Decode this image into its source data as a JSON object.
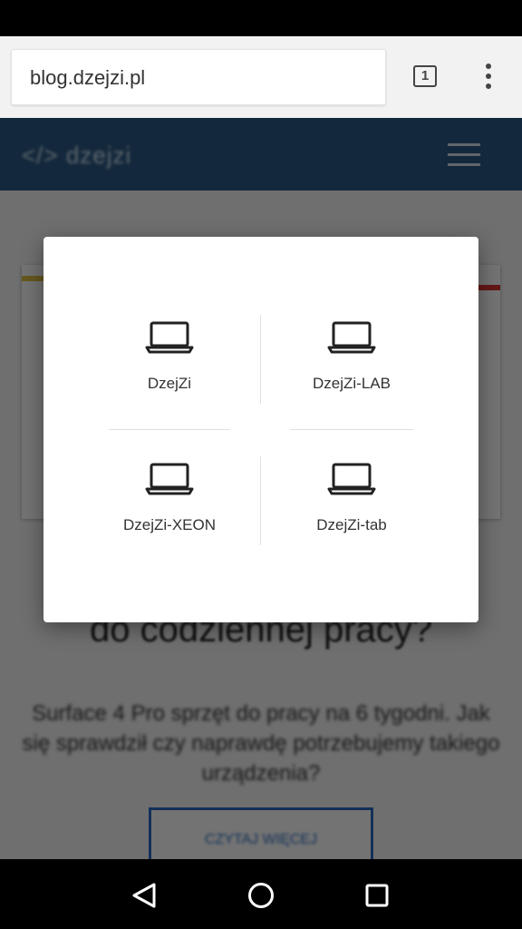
{
  "browser": {
    "url": "blog.dzejzi.pl",
    "tab_count": "1"
  },
  "dialog": {
    "devices": [
      {
        "label": "DzejZi",
        "icon": "laptop-icon"
      },
      {
        "label": "DzejZi-LAB",
        "icon": "laptop-icon"
      },
      {
        "label": "DzejZi-XEON",
        "icon": "laptop-icon"
      },
      {
        "label": "DzejZi-tab",
        "icon": "laptop-icon"
      }
    ]
  },
  "colors": {
    "site_header": "#2b5a85",
    "toolbar": "#f2f2f2",
    "scrim": "rgba(0,0,0,0.55)"
  },
  "nav": {
    "icons": [
      "back-icon",
      "home-icon",
      "recents-icon"
    ]
  }
}
